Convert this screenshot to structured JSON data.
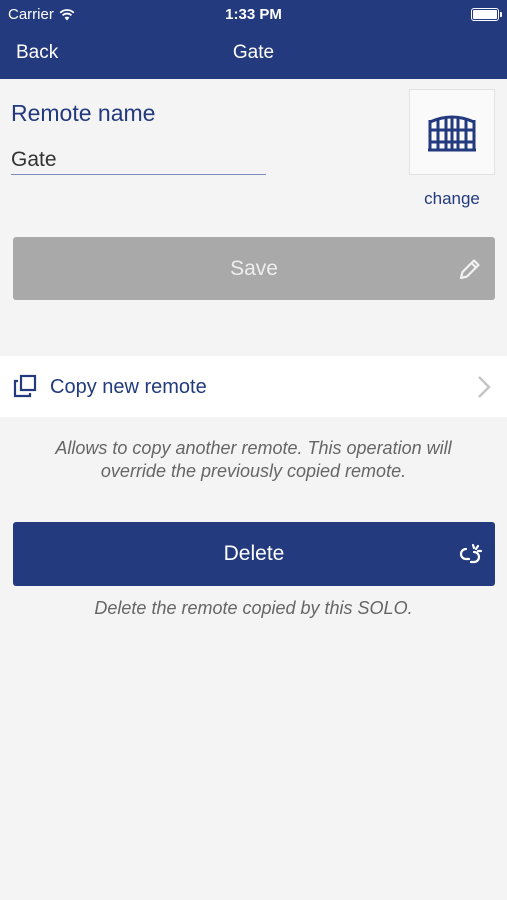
{
  "status_bar": {
    "carrier": "Carrier",
    "time": "1:33 PM",
    "icons": [
      "wifi-icon",
      "battery-icon"
    ]
  },
  "nav": {
    "back_label": "Back",
    "title": "Gate"
  },
  "form": {
    "name_label": "Remote name",
    "name_value": "Gate",
    "remote_icon": "gate-icon",
    "change_label": "change",
    "save_label": "Save",
    "save_icon": "pencil-icon"
  },
  "copy": {
    "label": "Copy new remote",
    "icon": "copy-icon",
    "chevron": "chevron-right-icon",
    "description_line1": "Allows to copy another remote. This operation will",
    "description_line2": "override the previously copied remote."
  },
  "delete": {
    "label": "Delete",
    "icon": "unlink-icon",
    "description": "Delete the remote copied by this SOLO."
  },
  "colors": {
    "primary": "#233a7e",
    "save_disabled": "#a9a9a9",
    "background": "#f4f4f4"
  }
}
